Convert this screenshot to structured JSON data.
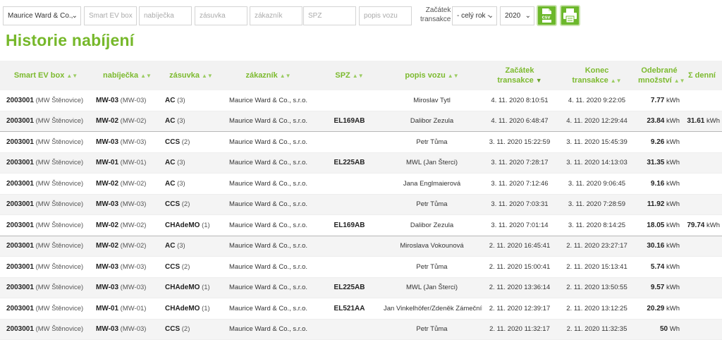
{
  "filters": {
    "customer_select": "Maurice Ward & Co.,",
    "ev_box_placeholder": "Smart EV box",
    "charger_placeholder": "nabíječka",
    "socket_placeholder": "zásuvka",
    "customer_placeholder": "zákazník",
    "spz_placeholder": "SPZ",
    "car_desc_placeholder": "popis vozu",
    "start_label_line1": "Začátek",
    "start_label_line2": "transakce",
    "period_select": "- celý rok -",
    "year_select": "2020",
    "csv_label": "csv"
  },
  "page_title": "Historie nabíjení",
  "columns": [
    {
      "label": "Smart EV box"
    },
    {
      "label": "nabíječka"
    },
    {
      "label": "zásuvka"
    },
    {
      "label": "zákazník"
    },
    {
      "label": "SPZ"
    },
    {
      "label": "popis vozu"
    },
    {
      "label1": "Začátek",
      "label2": "transakce"
    },
    {
      "label1": "Konec",
      "label2": "transakce"
    },
    {
      "label1": "Odebrané",
      "label2": "množství"
    },
    {
      "label": "Σ denní"
    }
  ],
  "rows": [
    {
      "box": "2003001",
      "box_loc": "(MW Štěnovice)",
      "charger": "MW-03",
      "charger_id": "(MW-03)",
      "socket": "AC",
      "socket_n": "(3)",
      "customer": "Maurice Ward & Co., s.r.o.",
      "spz": "",
      "car": "Miroslav Tytl",
      "start": "4. 11. 2020 8:10:51",
      "end": "4. 11. 2020 9:22:05",
      "amount": "7.77",
      "unit": "kWh",
      "daily": "",
      "daily_unit": ""
    },
    {
      "box": "2003001",
      "box_loc": "(MW Štěnovice)",
      "charger": "MW-02",
      "charger_id": "(MW-02)",
      "socket": "AC",
      "socket_n": "(3)",
      "customer": "Maurice Ward & Co., s.r.o.",
      "spz": "EL169AB",
      "car": "Dalibor Zezula",
      "start": "4. 11. 2020 6:48:47",
      "end": "4. 11. 2020 12:29:44",
      "amount": "23.84",
      "unit": "kWh",
      "daily": "31.61",
      "daily_unit": "kWh"
    },
    {
      "box": "2003001",
      "box_loc": "(MW Štěnovice)",
      "charger": "MW-03",
      "charger_id": "(MW-03)",
      "socket": "CCS",
      "socket_n": "(2)",
      "customer": "Maurice Ward & Co., s.r.o.",
      "spz": "",
      "car": "Petr Tůma",
      "start": "3. 11. 2020 15:22:59",
      "end": "3. 11. 2020 15:45:39",
      "amount": "9.26",
      "unit": "kWh",
      "daily": "",
      "daily_unit": ""
    },
    {
      "box": "2003001",
      "box_loc": "(MW Štěnovice)",
      "charger": "MW-01",
      "charger_id": "(MW-01)",
      "socket": "AC",
      "socket_n": "(3)",
      "customer": "Maurice Ward & Co., s.r.o.",
      "spz": "EL225AB",
      "car": "MWL (Jan Šterci)",
      "start": "3. 11. 2020 7:28:17",
      "end": "3. 11. 2020 14:13:03",
      "amount": "31.35",
      "unit": "kWh",
      "daily": "",
      "daily_unit": ""
    },
    {
      "box": "2003001",
      "box_loc": "(MW Štěnovice)",
      "charger": "MW-02",
      "charger_id": "(MW-02)",
      "socket": "AC",
      "socket_n": "(3)",
      "customer": "Maurice Ward & Co., s.r.o.",
      "spz": "",
      "car": "Jana Englmaierová",
      "start": "3. 11. 2020 7:12:46",
      "end": "3. 11. 2020 9:06:45",
      "amount": "9.16",
      "unit": "kWh",
      "daily": "",
      "daily_unit": ""
    },
    {
      "box": "2003001",
      "box_loc": "(MW Štěnovice)",
      "charger": "MW-03",
      "charger_id": "(MW-03)",
      "socket": "CCS",
      "socket_n": "(2)",
      "customer": "Maurice Ward & Co., s.r.o.",
      "spz": "",
      "car": "Petr Tůma",
      "start": "3. 11. 2020 7:03:31",
      "end": "3. 11. 2020 7:28:59",
      "amount": "11.92",
      "unit": "kWh",
      "daily": "",
      "daily_unit": ""
    },
    {
      "box": "2003001",
      "box_loc": "(MW Štěnovice)",
      "charger": "MW-02",
      "charger_id": "(MW-02)",
      "socket": "CHAdeMO",
      "socket_n": "(1)",
      "customer": "Maurice Ward & Co., s.r.o.",
      "spz": "EL169AB",
      "car": "Dalibor Zezula",
      "start": "3. 11. 2020 7:01:14",
      "end": "3. 11. 2020 8:14:25",
      "amount": "18.05",
      "unit": "kWh",
      "daily": "79.74",
      "daily_unit": "kWh"
    },
    {
      "box": "2003001",
      "box_loc": "(MW Štěnovice)",
      "charger": "MW-02",
      "charger_id": "(MW-02)",
      "socket": "AC",
      "socket_n": "(3)",
      "customer": "Maurice Ward & Co., s.r.o.",
      "spz": "",
      "car": "Miroslava Vokounová",
      "start": "2. 11. 2020 16:45:41",
      "end": "2. 11. 2020 23:27:17",
      "amount": "30.16",
      "unit": "kWh",
      "daily": "",
      "daily_unit": ""
    },
    {
      "box": "2003001",
      "box_loc": "(MW Štěnovice)",
      "charger": "MW-03",
      "charger_id": "(MW-03)",
      "socket": "CCS",
      "socket_n": "(2)",
      "customer": "Maurice Ward & Co., s.r.o.",
      "spz": "",
      "car": "Petr Tůma",
      "start": "2. 11. 2020 15:00:41",
      "end": "2. 11. 2020 15:13:41",
      "amount": "5.74",
      "unit": "kWh",
      "daily": "",
      "daily_unit": ""
    },
    {
      "box": "2003001",
      "box_loc": "(MW Štěnovice)",
      "charger": "MW-03",
      "charger_id": "(MW-03)",
      "socket": "CHAdeMO",
      "socket_n": "(1)",
      "customer": "Maurice Ward & Co., s.r.o.",
      "spz": "EL225AB",
      "car": "MWL (Jan Šterci)",
      "start": "2. 11. 2020 13:36:14",
      "end": "2. 11. 2020 13:50:55",
      "amount": "9.57",
      "unit": "kWh",
      "daily": "",
      "daily_unit": ""
    },
    {
      "box": "2003001",
      "box_loc": "(MW Štěnovice)",
      "charger": "MW-01",
      "charger_id": "(MW-01)",
      "socket": "CHAdeMO",
      "socket_n": "(1)",
      "customer": "Maurice Ward & Co., s.r.o.",
      "spz": "EL521AA",
      "car": "Jan Vinkelhöfer/Zdeněk Zámečník",
      "start": "2. 11. 2020 12:39:17",
      "end": "2. 11. 2020 13:12:25",
      "amount": "20.29",
      "unit": "kWh",
      "daily": "",
      "daily_unit": ""
    },
    {
      "box": "2003001",
      "box_loc": "(MW Štěnovice)",
      "charger": "MW-03",
      "charger_id": "(MW-03)",
      "socket": "CCS",
      "socket_n": "(2)",
      "customer": "Maurice Ward & Co., s.r.o.",
      "spz": "",
      "car": "Petr Tůma",
      "start": "2. 11. 2020 11:32:17",
      "end": "2. 11. 2020 11:32:35",
      "amount": "50",
      "unit": "Wh",
      "daily": "",
      "daily_unit": ""
    }
  ],
  "group_end_rows": [
    1,
    6
  ],
  "colors": {
    "accent": "#76b82a",
    "header_bg": "#f2f2f2",
    "button_bg": "#6cb82b"
  },
  "icons": {
    "csv": "csv-export-icon",
    "print": "printer-icon",
    "sort": "sort-icon",
    "sort_desc": "sort-desc-icon"
  }
}
